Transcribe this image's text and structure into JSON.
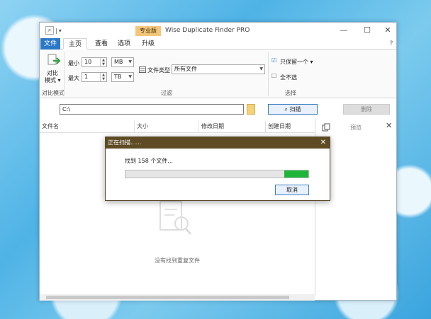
{
  "window": {
    "title": "Wise Duplicate Finder PRO",
    "pro_badge": "专业版",
    "quick_access_sep": "|",
    "quick_access_dropdown": "▾",
    "minimize": "—",
    "maximize": "☐",
    "close": "✕",
    "help": "?"
  },
  "tabs": [
    {
      "label": "文件"
    },
    {
      "label": "主页"
    },
    {
      "label": "查看"
    },
    {
      "label": "选项"
    },
    {
      "label": "升级"
    }
  ],
  "ribbon": {
    "compare": {
      "label1": "对比",
      "label2": "模式 ▾",
      "group": "对比模式"
    },
    "filter": {
      "min_label": "最小",
      "min_value": "10",
      "min_unit": "MB",
      "max_label": "最大",
      "max_value": "1",
      "max_unit": "TB",
      "filetype_label": "文件类型",
      "filetype_value": "所有文件",
      "group": "过滤"
    },
    "select": {
      "keep_one": "只保留一个 ▾",
      "select_none": "全不选",
      "group": "选择"
    }
  },
  "search": {
    "path": "C:\\",
    "scan_label": "扫描",
    "delete_label": "删除"
  },
  "columns": [
    "文件名",
    "大小",
    "修改日期",
    "创建日期"
  ],
  "preview": {
    "label": "预览"
  },
  "empty_text": "没有找到重复文件",
  "dialog": {
    "title": "正在扫描......",
    "found_text": "找到 158 个文件...",
    "progress": 0.13,
    "cancel_label": "取消"
  },
  "colors": {
    "accent": "#2b78c6",
    "progress": "#1fb53a",
    "dialog_title": "#5e4b24"
  }
}
